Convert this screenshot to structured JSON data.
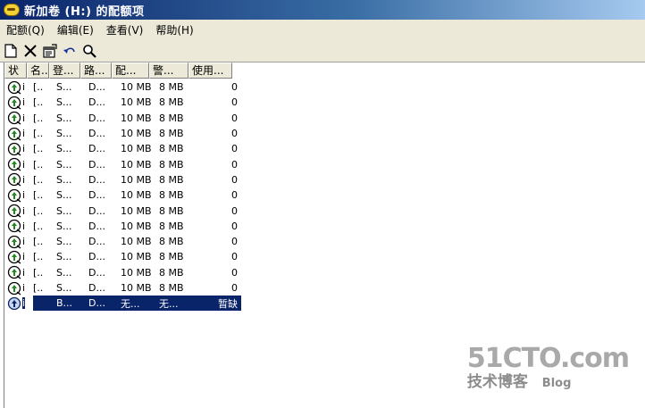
{
  "window": {
    "title": "新加卷 (H:) 的配额项"
  },
  "menubar": {
    "items": [
      "配额(Q)",
      "编辑(E)",
      "查看(V)",
      "帮助(H)"
    ]
  },
  "toolbar": {
    "buttons": [
      "new-entry-icon",
      "delete-icon",
      "properties-icon",
      "undo-icon",
      "find-icon"
    ]
  },
  "list": {
    "columns": [
      "状",
      "名..",
      "登...",
      "路...",
      "配...",
      "警...",
      "使用..."
    ],
    "rows": [
      {
        "flag": "i",
        "name": "[..",
        "login": "S...",
        "path": "D...",
        "limit": "10 MB",
        "warn": "8 MB",
        "used": "0"
      },
      {
        "flag": "i",
        "name": "[..",
        "login": "S...",
        "path": "D...",
        "limit": "10 MB",
        "warn": "8 MB",
        "used": "0"
      },
      {
        "flag": "i",
        "name": "[..",
        "login": "S...",
        "path": "D...",
        "limit": "10 MB",
        "warn": "8 MB",
        "used": "0"
      },
      {
        "flag": "i",
        "name": "[..",
        "login": "S...",
        "path": "D...",
        "limit": "10 MB",
        "warn": "8 MB",
        "used": "0"
      },
      {
        "flag": "i",
        "name": "[..",
        "login": "S...",
        "path": "D...",
        "limit": "10 MB",
        "warn": "8 MB",
        "used": "0"
      },
      {
        "flag": "i",
        "name": "[..",
        "login": "S...",
        "path": "D...",
        "limit": "10 MB",
        "warn": "8 MB",
        "used": "0"
      },
      {
        "flag": "i",
        "name": "[..",
        "login": "S...",
        "path": "D...",
        "limit": "10 MB",
        "warn": "8 MB",
        "used": "0"
      },
      {
        "flag": "i",
        "name": "[..",
        "login": "S...",
        "path": "D...",
        "limit": "10 MB",
        "warn": "8 MB",
        "used": "0"
      },
      {
        "flag": "i",
        "name": "[..",
        "login": "S...",
        "path": "D...",
        "limit": "10 MB",
        "warn": "8 MB",
        "used": "0"
      },
      {
        "flag": "i",
        "name": "[..",
        "login": "S...",
        "path": "D...",
        "limit": "10 MB",
        "warn": "8 MB",
        "used": "0"
      },
      {
        "flag": "i",
        "name": "[..",
        "login": "S...",
        "path": "D...",
        "limit": "10 MB",
        "warn": "8 MB",
        "used": "0"
      },
      {
        "flag": "i",
        "name": "[..",
        "login": "S...",
        "path": "D...",
        "limit": "10 MB",
        "warn": "8 MB",
        "used": "0"
      },
      {
        "flag": "i",
        "name": "[..",
        "login": "S...",
        "path": "D...",
        "limit": "10 MB",
        "warn": "8 MB",
        "used": "0"
      },
      {
        "flag": "i",
        "name": "[..",
        "login": "S...",
        "path": "D...",
        "limit": "10 MB",
        "warn": "8 MB",
        "used": "0"
      },
      {
        "flag": "i",
        "name": "",
        "login": "B...",
        "path": "D...",
        "limit": "无...",
        "warn": "无...",
        "used": "暂缺",
        "selected": true
      }
    ]
  },
  "watermark": {
    "site": "51CTO.com",
    "tagline": "技术博客",
    "blog": "Blog"
  }
}
